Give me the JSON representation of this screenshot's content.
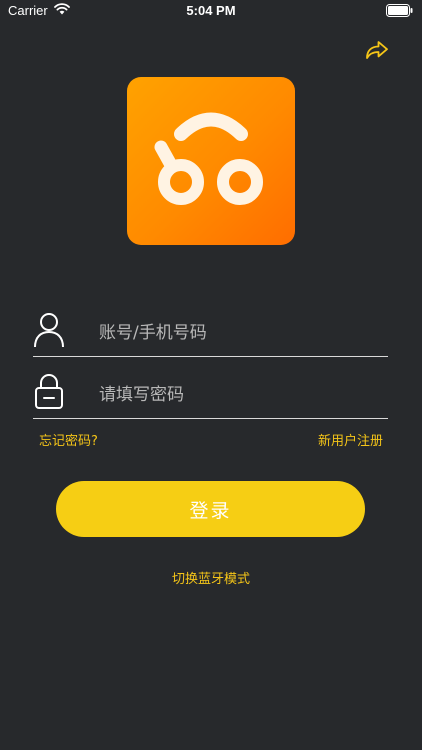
{
  "status_bar": {
    "carrier": "Carrier",
    "time": "5:04 PM"
  },
  "header": {
    "share_icon": "share-arrow-icon",
    "accent_color": "#f5c518"
  },
  "logo": {
    "icon": "app-logo-icon",
    "gradient": [
      "#ffa200",
      "#ff6d00"
    ]
  },
  "form": {
    "account": {
      "icon": "user-icon",
      "placeholder": "账号/手机号码",
      "value": ""
    },
    "password": {
      "icon": "lock-icon",
      "placeholder": "请填写密码",
      "value": ""
    },
    "forgot_password": "忘记密码?",
    "register": "新用户注册",
    "login_button": "登录",
    "login_button_color": "#f6ce14"
  },
  "footer": {
    "switch_bluetooth": "切换蓝牙模式"
  },
  "background_color": "#27292c"
}
